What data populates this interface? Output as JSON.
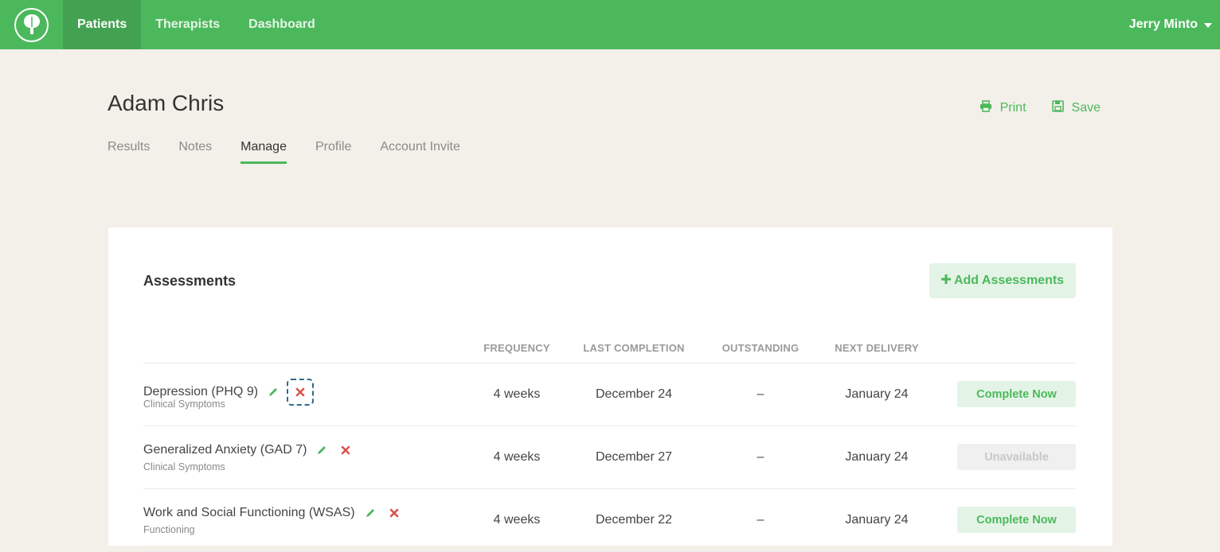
{
  "nav": {
    "logo_icon": "tree-logo-icon",
    "items": [
      {
        "label": "Patients",
        "active": true
      },
      {
        "label": "Therapists",
        "active": false
      },
      {
        "label": "Dashboard",
        "active": false
      }
    ],
    "user_name": "Jerry Minto"
  },
  "patient": {
    "name": "Adam Chris"
  },
  "header_actions": {
    "print_label": "Print",
    "save_label": "Save"
  },
  "tabs": [
    {
      "label": "Results",
      "active": false
    },
    {
      "label": "Notes",
      "active": false
    },
    {
      "label": "Manage",
      "active": true
    },
    {
      "label": "Profile",
      "active": false
    },
    {
      "label": "Account Invite",
      "active": false
    }
  ],
  "assessments": {
    "title": "Assessments",
    "add_button_label": "Add Assessments",
    "columns": {
      "frequency": "FREQUENCY",
      "last_completion": "LAST COMPLETION",
      "outstanding": "OUTSTANDING",
      "next_delivery": "NEXT DELIVERY"
    },
    "rows": [
      {
        "name": "Depression (PHQ 9)",
        "category": "Clinical Symptoms",
        "frequency": "4 weeks",
        "last_completion": "December 24",
        "outstanding": "–",
        "next_delivery": "January 24",
        "action": "Complete Now",
        "action_state": "complete"
      },
      {
        "name": "Generalized Anxiety (GAD 7)",
        "category": "Clinical Symptoms",
        "frequency": "4 weeks",
        "last_completion": "December 27",
        "outstanding": "–",
        "next_delivery": "January 24",
        "action": "Unavailable",
        "action_state": "unavailable"
      },
      {
        "name": "Work and Social Functioning (WSAS)",
        "category": "Functioning",
        "frequency": "4 weeks",
        "last_completion": "December 22",
        "outstanding": "–",
        "next_delivery": "January 24",
        "action": "Complete Now",
        "action_state": "complete"
      }
    ]
  },
  "colors": {
    "brand_green": "#4cb85c",
    "delete_red": "#d9534f",
    "background": "#f3f0ea"
  }
}
